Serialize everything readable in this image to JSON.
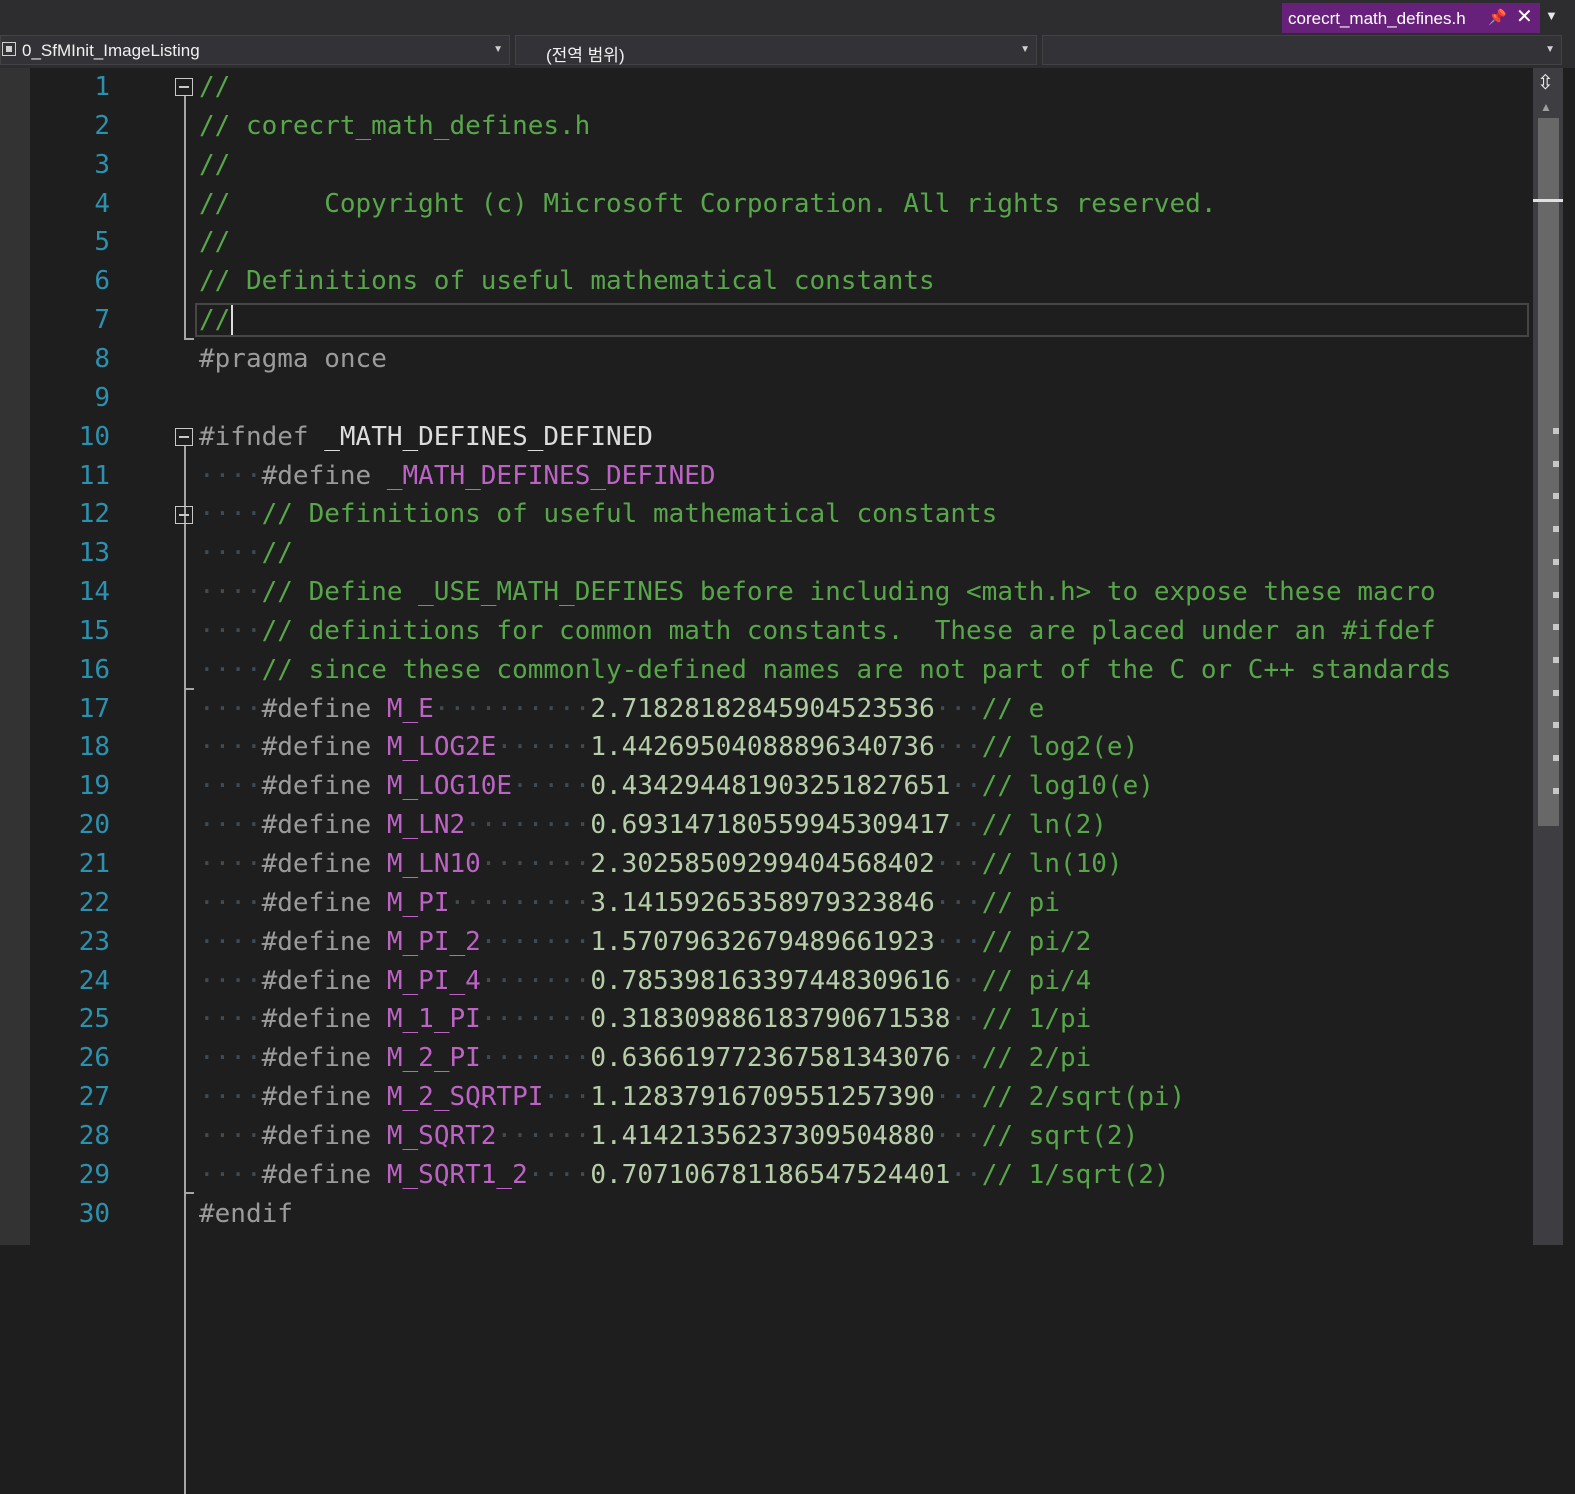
{
  "tab": {
    "title": "corecrt_math_defines.h",
    "pin_icon": "pin-icon",
    "close_glyph": "✕"
  },
  "navbar": {
    "project": "0_SfMInit_ImageListing",
    "scope": "(전역 범위)",
    "member": ""
  },
  "colors": {
    "tab_active": "#68217a",
    "comment": "#57a64a",
    "preprocessor": "#9b9b9b",
    "macro": "#bd63c5",
    "number": "#b5cea8",
    "line_number": "#2b91af",
    "background": "#1e1e1e"
  },
  "editor": {
    "line_numbers": [
      "1",
      "2",
      "3",
      "4",
      "5",
      "6",
      "7",
      "8",
      "9",
      "10",
      "11",
      "12",
      "13",
      "14",
      "15",
      "16",
      "17",
      "18",
      "19",
      "20",
      "21",
      "22",
      "23",
      "24",
      "25",
      "26",
      "27",
      "28",
      "29",
      "30"
    ],
    "header_comment": [
      "//",
      "// corecrt_math_defines.h",
      "//",
      "//      Copyright (c) Microsoft Corporation. All rights reserved.",
      "//",
      "// Definitions of useful mathematical constants",
      "//"
    ],
    "pragma": {
      "directive": "#pragma",
      "arg": "once"
    },
    "ifndef": {
      "directive": "#ifndef",
      "macro": "_MATH_DEFINES_DEFINED"
    },
    "guard_define": {
      "directive": "#define",
      "macro": "_MATH_DEFINES_DEFINED"
    },
    "block_comment": [
      "// Definitions of useful mathematical constants",
      "//",
      "// Define _USE_MATH_DEFINES before including <math.h> to expose these macro",
      "// definitions for common math constants.  These are placed under an #ifdef",
      "// since these commonly-defined names are not part of the C or C++ standards"
    ],
    "defines": [
      {
        "directive": "#define",
        "name": "M_E",
        "value": "2.71828182845904523536",
        "comment": "// e"
      },
      {
        "directive": "#define",
        "name": "M_LOG2E",
        "value": "1.44269504088896340736",
        "comment": "// log2(e)"
      },
      {
        "directive": "#define",
        "name": "M_LOG10E",
        "value": "0.434294481903251827651",
        "comment": "// log10(e)"
      },
      {
        "directive": "#define",
        "name": "M_LN2",
        "value": "0.693147180559945309417",
        "comment": "// ln(2)"
      },
      {
        "directive": "#define",
        "name": "M_LN10",
        "value": "2.30258509299404568402",
        "comment": "// ln(10)"
      },
      {
        "directive": "#define",
        "name": "M_PI",
        "value": "3.14159265358979323846",
        "comment": "// pi"
      },
      {
        "directive": "#define",
        "name": "M_PI_2",
        "value": "1.57079632679489661923",
        "comment": "// pi/2"
      },
      {
        "directive": "#define",
        "name": "M_PI_4",
        "value": "0.785398163397448309616",
        "comment": "// pi/4"
      },
      {
        "directive": "#define",
        "name": "M_1_PI",
        "value": "0.318309886183790671538",
        "comment": "// 1/pi"
      },
      {
        "directive": "#define",
        "name": "M_2_PI",
        "value": "0.636619772367581343076",
        "comment": "// 2/pi"
      },
      {
        "directive": "#define",
        "name": "M_2_SQRTPI",
        "value": "1.12837916709551257390",
        "comment": "// 2/sqrt(pi)"
      },
      {
        "directive": "#define",
        "name": "M_SQRT2",
        "value": "1.41421356237309504880",
        "comment": "// sqrt(2)"
      },
      {
        "directive": "#define",
        "name": "M_SQRT1_2",
        "value": "0.707106781186547524401",
        "comment": "// 1/sqrt(2)"
      }
    ],
    "endif": "#endif"
  }
}
